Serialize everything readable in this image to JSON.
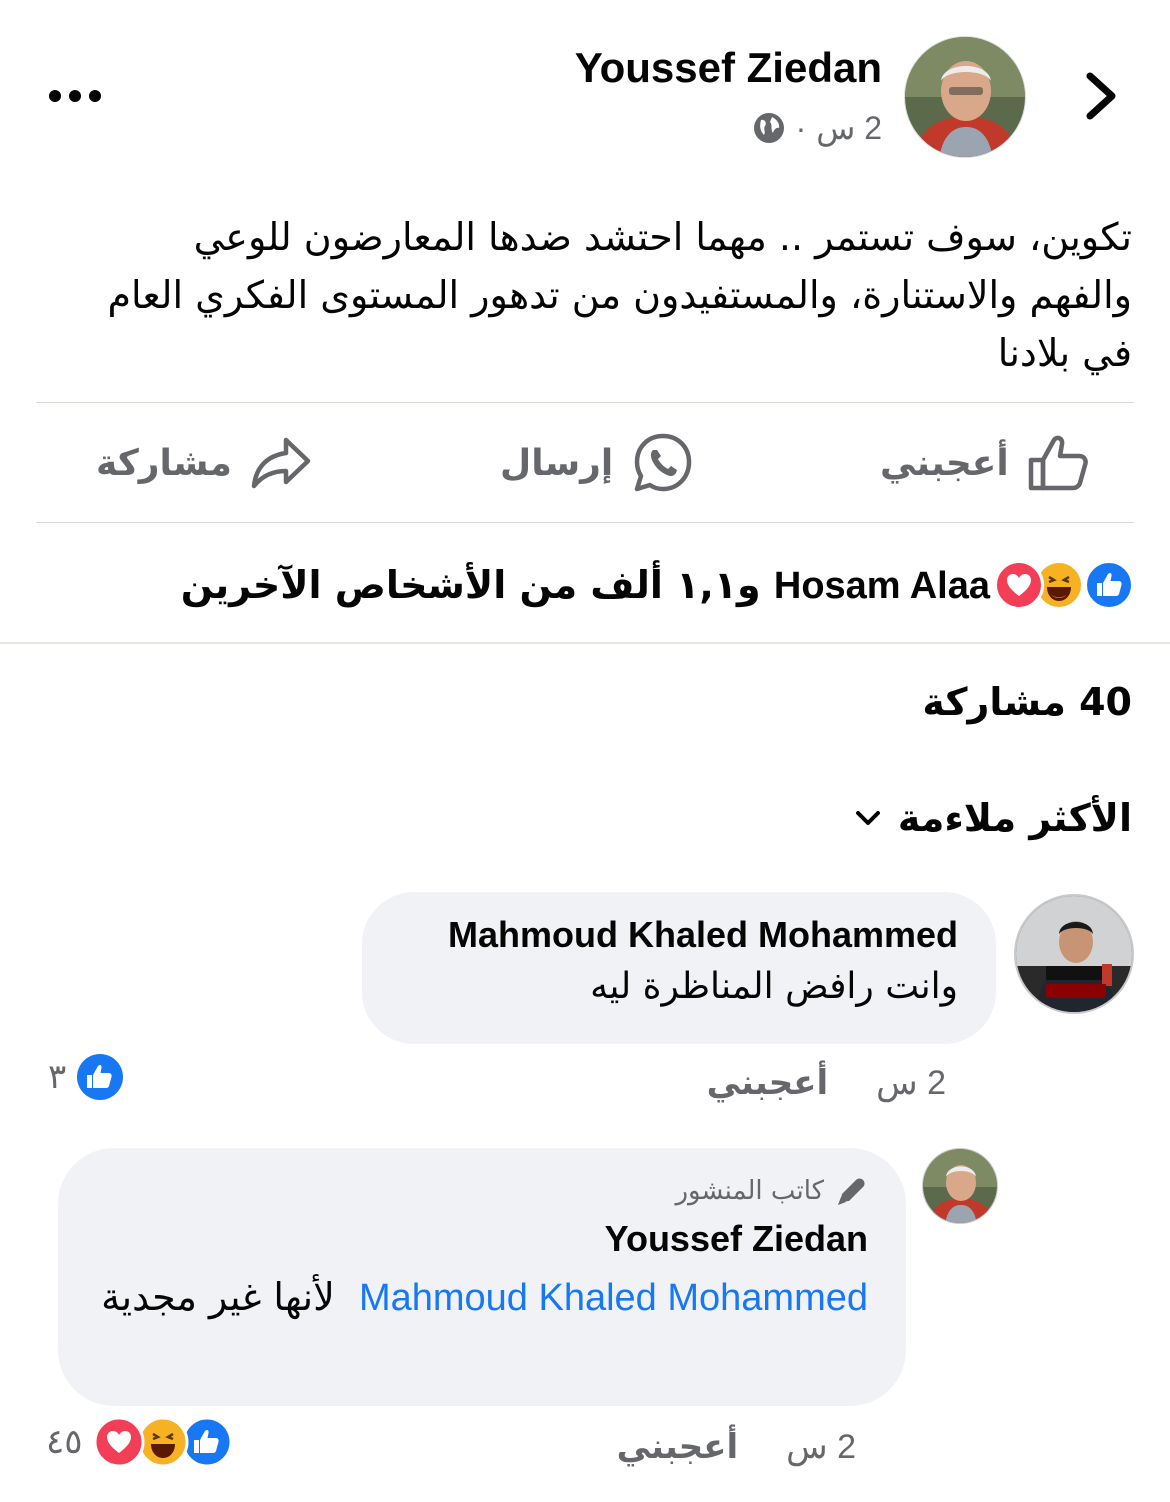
{
  "post": {
    "author": "Youssef Ziedan",
    "time": "2 س",
    "separator": "·",
    "text": "تكوين، سوف تستمر .. مهما احتشد ضدها المعارضون للوعي والفهم والاستنارة، والمستفيدون من تدهور المستوى الفكري العام في بلادنا"
  },
  "actions": {
    "like": "أعجبني",
    "send": "إرسال",
    "share": "مشاركة"
  },
  "reactions": {
    "name": "Hosam Alaa",
    "others": "و١,١ ألف من الأشخاص الآخرين",
    "types": [
      "like-icon",
      "haha-icon",
      "love-icon"
    ]
  },
  "shares": "40 مشاركة",
  "sort": "الأكثر ملاءمة",
  "comments": [
    {
      "author": "Mahmoud Khaled Mohammed",
      "text": "وانت رافض المناظرة ليه",
      "time": "2 س",
      "like_label": "أعجبني",
      "reaction_count": "٣"
    },
    {
      "badge": "كاتب المنشور",
      "author": "Youssef Ziedan",
      "mention": "Mahmoud Khaled Mohammed",
      "text": "لأنها غير مجدية",
      "time": "2 س",
      "like_label": "أعجبني",
      "reaction_count": "٤٥"
    }
  ],
  "colors": {
    "accent": "#1877f2",
    "secondary_text": "#65676b",
    "bubble": "#f0f2f5",
    "love": "#f33e58",
    "haha": "#f7b125"
  }
}
